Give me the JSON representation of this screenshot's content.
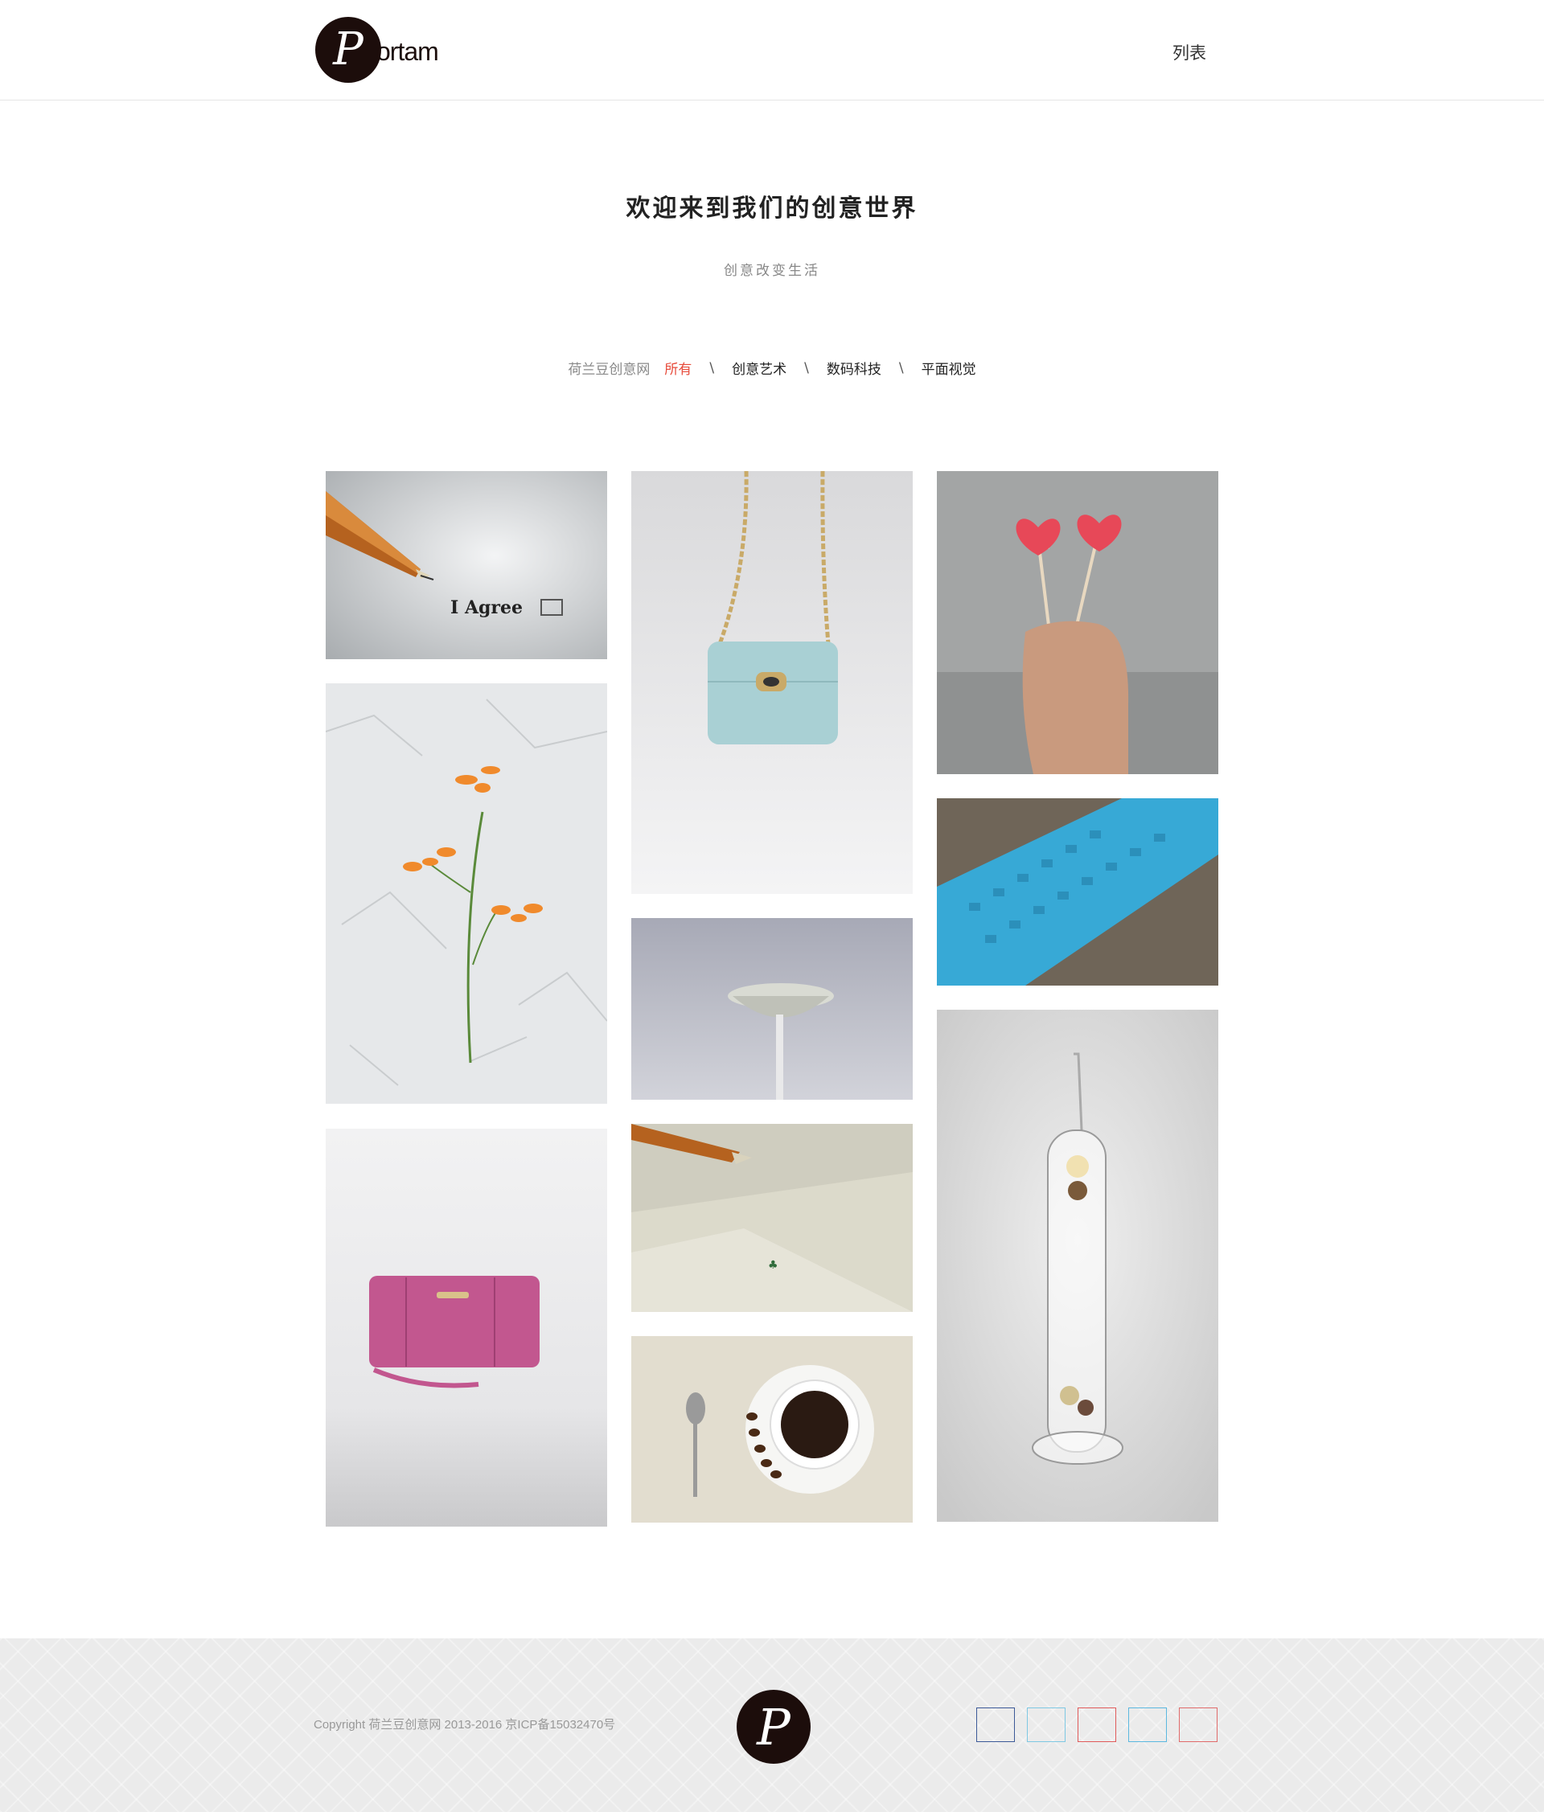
{
  "header": {
    "logo_text": "ortam",
    "logo_letter": "P",
    "menu_label": "列表"
  },
  "hero": {
    "title": "欢迎来到我们的创意世界",
    "subtitle": "创意改变生活"
  },
  "filter": {
    "brand": "荷兰豆创意网",
    "items": [
      "所有",
      "创意艺术",
      "数码科技",
      "平面视觉"
    ],
    "separator": "\\",
    "active_index": 0,
    "active_color": "#e74c3c"
  },
  "gallery": {
    "items": [
      {
        "subject": "pen-agree",
        "text": "I Agree"
      },
      {
        "subject": "orange-flower"
      },
      {
        "subject": "pink-wallet"
      },
      {
        "subject": "blue-handbag"
      },
      {
        "subject": "street-lamp"
      },
      {
        "subject": "pen-envelope"
      },
      {
        "subject": "coffee-cup"
      },
      {
        "subject": "heart-lollipops"
      },
      {
        "subject": "blue-keyboard"
      },
      {
        "subject": "glass-thermometer"
      }
    ]
  },
  "footer": {
    "copyright": "Copyright 荷兰豆创意网 2013-2016 京ICP备15032470号",
    "logo_letter": "P",
    "socials": [
      {
        "icon": "social-icon-1",
        "color": "#3b5998"
      },
      {
        "icon": "social-icon-2",
        "color": "#7ec8e3"
      },
      {
        "icon": "social-icon-3",
        "color": "#e05a5a"
      },
      {
        "icon": "social-icon-4",
        "color": "#5bb8e0"
      },
      {
        "icon": "social-icon-5",
        "color": "#e06a6a"
      }
    ]
  }
}
